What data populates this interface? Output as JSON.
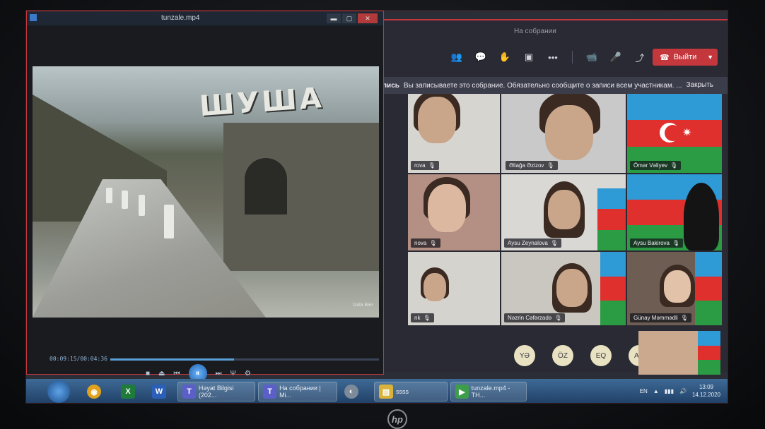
{
  "player": {
    "title": "tunzale.mp4",
    "time": "00:09:15/00:04:36",
    "sign_text": "ШУША",
    "watermark": "Gala Bier",
    "progress": 0.46,
    "window_buttons": {
      "minimize": "▬",
      "maximize": "▢",
      "close": "✕"
    },
    "control_glyphs": {
      "stop": "■",
      "prev": "⏮",
      "play": "⏸",
      "next": "⏭",
      "eject": "⏏",
      "eq": "Ψ",
      "settings": "⚙"
    }
  },
  "teams": {
    "window_title": "На собрании",
    "leave_label": "Выйти",
    "banner_prefix": "пись",
    "banner_text": "Вы записываете это собрание. Обязательно сообщите о записи всем участникам. ...",
    "banner_close": "Закрыть",
    "toolbar_glyphs": {
      "participants": "👥",
      "chat": "💬",
      "raise-hand": "✋",
      "rooms": "▣",
      "more": "•••",
      "camera": "📹",
      "mic": "🎤",
      "share": "⤴"
    },
    "tiles": [
      {
        "name": "rova"
      },
      {
        "name": "Əliağa Əzizov"
      },
      {
        "name": "Ömər Vəliyev"
      },
      {
        "name": "nova"
      },
      {
        "name": "Aysu Zeynalova"
      },
      {
        "name": "Aysu Bakirova"
      },
      {
        "name": "nk"
      },
      {
        "name": "Nəzrin Cəfərzadə"
      },
      {
        "name": "Günay Məmmədli"
      }
    ],
    "avatars": [
      "YƏ",
      "ÖZ",
      "EQ",
      "AR"
    ]
  },
  "taskbar": {
    "apps": [
      {
        "label": "",
        "glyph": "◉",
        "color": "#e0a21c"
      },
      {
        "label": "",
        "glyph": "X",
        "color": "#1e7b3a"
      },
      {
        "label": "",
        "glyph": "W",
        "color": "#2b5fb8"
      },
      {
        "label": "Həyat Bilgisi (202...",
        "glyph": "T",
        "color": "#5b5fc7"
      },
      {
        "label": "На собрании | Mi...",
        "glyph": "T",
        "color": "#5b5fc7"
      },
      {
        "label": "",
        "glyph": "◐",
        "color": "#7d8a99"
      },
      {
        "label": "ssss",
        "glyph": "▤",
        "color": "#d9b23a"
      },
      {
        "label": "tunzale.mp4 - TH...",
        "glyph": "▶",
        "color": "#3e9d4b"
      }
    ],
    "language": "EN",
    "time": "13:09",
    "date": "14.12.2020"
  }
}
